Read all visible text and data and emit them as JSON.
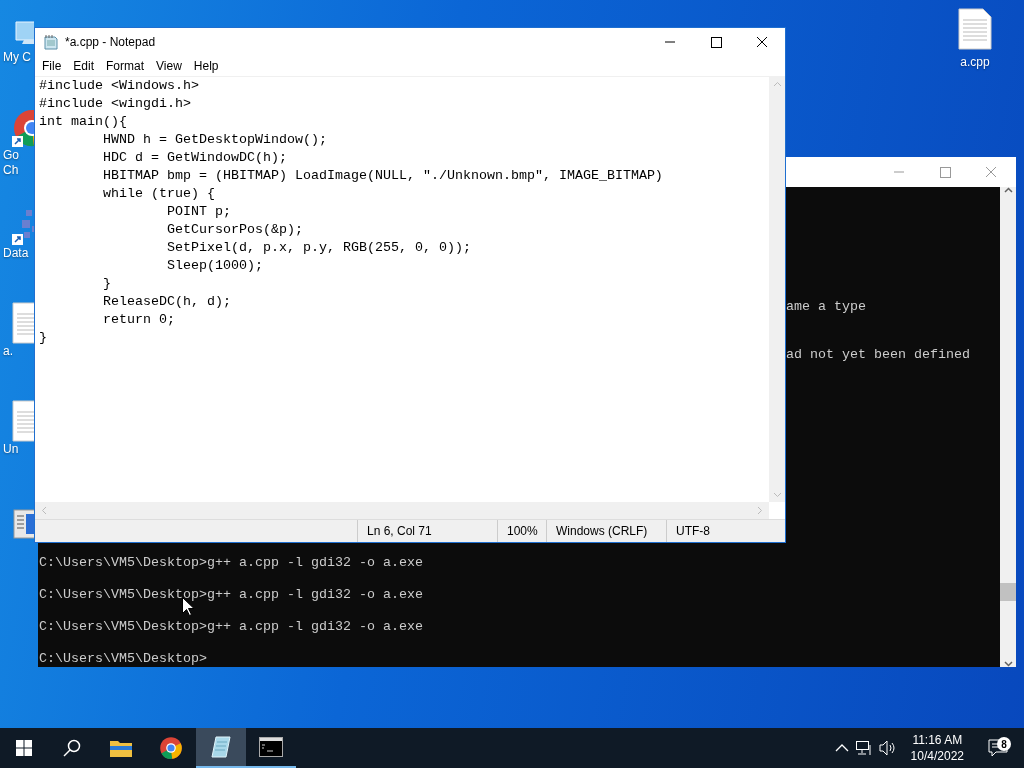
{
  "desktop_icons": [
    {
      "kind": "computer",
      "lines": [
        "My C"
      ]
    },
    {
      "kind": "chrome",
      "shortcut": true,
      "lines": [
        "Go",
        "Ch"
      ]
    },
    {
      "kind": "app",
      "shortcut": true,
      "lines": [
        "Data"
      ]
    },
    {
      "kind": "file",
      "lines": [
        "a."
      ]
    },
    {
      "kind": "file",
      "lines": [
        "Un"
      ]
    },
    {
      "kind": "document"
    }
  ],
  "desktop_file": {
    "kind": "file",
    "label": "a.cpp"
  },
  "console": {
    "output_fragments": [
      "ame a type",
      "ad not yet been defined"
    ],
    "lines": [
      "C:\\Users\\VM5\\Desktop>g++ a.cpp -l gdi32 -o a.exe",
      "C:\\Users\\VM5\\Desktop>g++ a.cpp -l gdi32 -o a.exe",
      "C:\\Users\\VM5\\Desktop>g++ a.cpp -l gdi32 -o a.exe",
      "C:\\Users\\VM5\\Desktop>"
    ]
  },
  "notepad": {
    "title": "*a.cpp - Notepad",
    "menu": [
      "File",
      "Edit",
      "Format",
      "View",
      "Help"
    ],
    "lines": [
      "#include <Windows.h>",
      "#include <wingdi.h>",
      "int main(){",
      "\tHWND h = GetDesktopWindow();",
      "\tHDC d = GetWindowDC(h);",
      "\tHBITMAP bmp = (HBITMAP) LoadImage(NULL, \"./Unknown.bmp\", IMAGE_BITMAP)",
      "\twhile (true) {",
      "\t\tPOINT p;",
      "\t\tGetCursorPos(&p);",
      "\t\tSetPixel(d, p.x, p.y, RGB(255, 0, 0));",
      "\t\tSleep(1000);",
      "\t}",
      "\tReleaseDC(h, d);",
      "\treturn 0;",
      "}"
    ],
    "status": [
      "Ln 6, Col 71",
      "100%",
      "Windows (CRLF)",
      "UTF-8"
    ]
  },
  "taskbar": {
    "apps": [
      {
        "kind": "explorer",
        "running": false,
        "selected": false
      },
      {
        "kind": "chrome",
        "running": false,
        "selected": false
      },
      {
        "kind": "notepad",
        "running": true,
        "selected": true
      },
      {
        "kind": "console",
        "running": true,
        "selected": false
      }
    ],
    "time": "11:16 AM",
    "date": "10/4/2022",
    "notifications": "8"
  }
}
